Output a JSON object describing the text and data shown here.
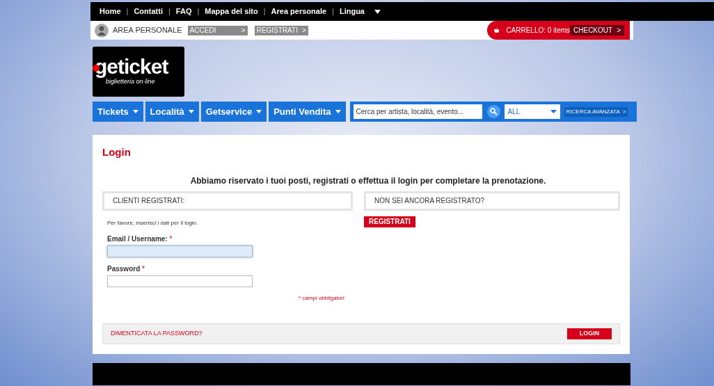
{
  "top_links": [
    "Home",
    "Contatti",
    "FAQ",
    "Mappa del sito",
    "Area personale",
    "Lingua"
  ],
  "top_separator": "|",
  "account_bar": {
    "label": "AREA PERSONALE",
    "buttons": [
      {
        "label": "ACCEDI",
        "arrow": ">"
      },
      {
        "label": "REGISTRATI",
        "arrow": ">"
      }
    ]
  },
  "cart": {
    "label": "CARRELLO: 0 items",
    "checkout": "CHECKOUT",
    "arrow": ">"
  },
  "logo": {
    "name": "geticket",
    "tagline": "biglietteria on-line"
  },
  "menu": [
    "Tickets",
    "Località",
    "Getservice",
    "Punti Vendita"
  ],
  "search": {
    "placeholder": "Cerca per artista, località, evento...",
    "category": "ALL",
    "advanced": "RICERCA AVANZATA",
    "arrow": ">"
  },
  "login": {
    "title": "Login",
    "intro": "Abbiamo riservato i tuoi posti, registrati o effettua il login per completare la prenotazione.",
    "left_heading": "CLIENTI REGISTRATI:",
    "right_heading": "NON SEI ANCORA REGISTRATO?",
    "register_button": "REGISTRATI",
    "hint": "Per favore, inserisci i dati per il login.",
    "fields": [
      {
        "label": "Email / Username:",
        "required": "*",
        "focused": true
      },
      {
        "label": "Password",
        "required": "*",
        "focused": false
      }
    ],
    "required_note": "* campi obbligatori",
    "forgot": "DIMENTICATA LA PASSWORD?",
    "submit": "LOGIN"
  }
}
